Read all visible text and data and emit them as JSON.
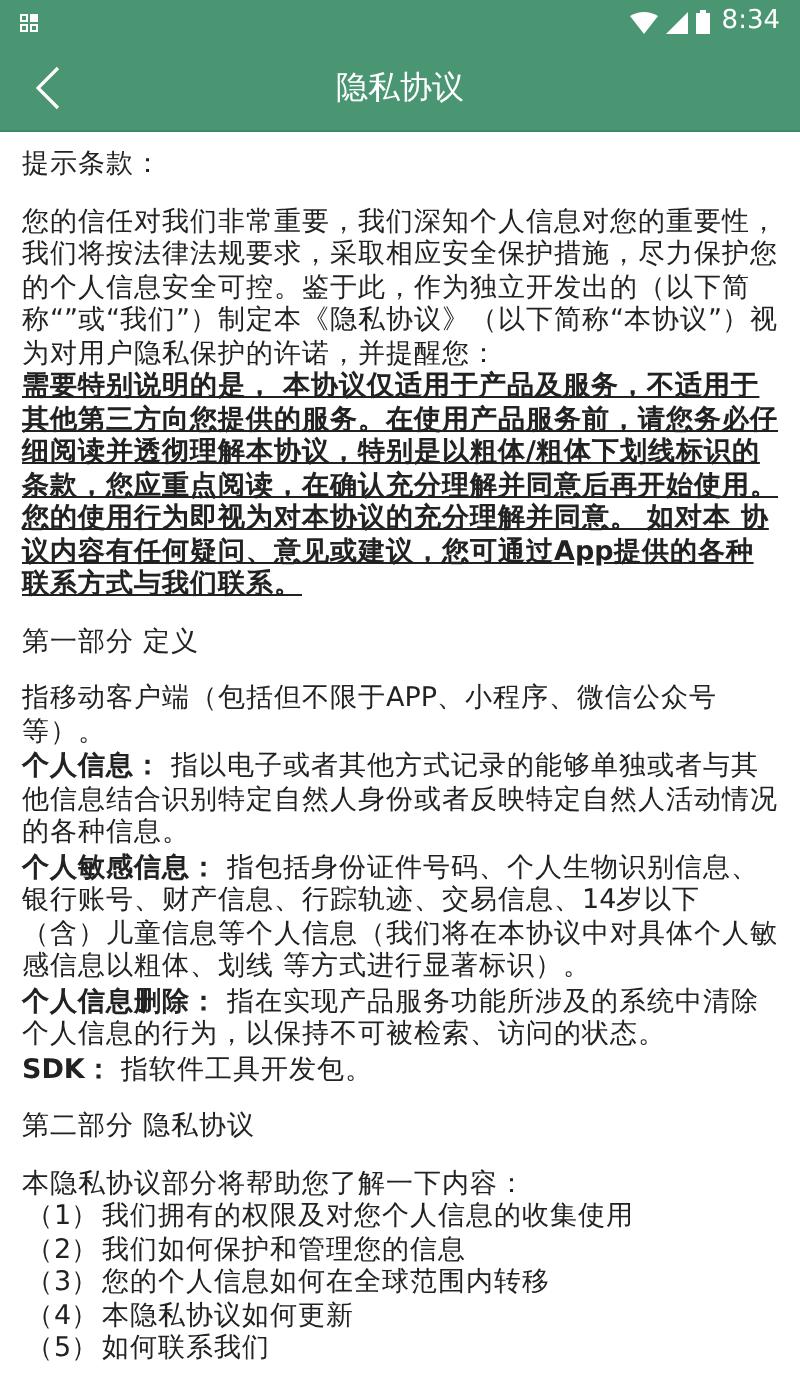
{
  "status_bar": {
    "time": "8:34"
  },
  "header": {
    "title": "隐私协议"
  },
  "blocks": [
    {
      "kind": "paragraph",
      "text": "提示条款："
    },
    {
      "kind": "gap"
    },
    {
      "kind": "paragraph",
      "text": "您的信任对我们非常重要，我们深知个人信息对您的重要性，我们将按法律法规要求，采取相应安全保护措施，尽力保护您的个人信息安全可控。鉴于此，作为独立开发出的（以下简称“”或“我们”）制定本《隐私协议》（以下简称“本协议”）视为对用户隐私保护的许诺，并提醒您："
    },
    {
      "kind": "notice",
      "text": "需要特别说明的是， 本协议仅适用于产品及服务，不适用于其他第三方向您提供的服务。在使用产品服务前，请您务必仔细阅读并透彻理解本协议，特别是以粗体/粗体下划线标识的条款，您应重点阅读，在确认充分理解并同意后再开始使用。您的使用行为即视为对本协议的充分理解并同意。 如对本 协议内容有任何疑问、意见或建议，您可通过App提供的各种联系方式与我们联系。"
    },
    {
      "kind": "gap"
    },
    {
      "kind": "paragraph",
      "text": "第一部分  定义"
    },
    {
      "kind": "gap"
    },
    {
      "kind": "paragraph",
      "text": "指移动客户端（包括但不限于APP、小程序、微信公众号等）。"
    },
    {
      "kind": "definition",
      "term": "个人信息：",
      "text": " 指以电子或者其他方式记录的能够单独或者与其他信息结合识别特定自然人身份或者反映特定自然人活动情况的各种信息。"
    },
    {
      "kind": "definition",
      "term": "个人敏感信息：",
      "text": " 指包括身份证件号码、个人生物识别信息、银行账号、财产信息、行踪轨迹、交易信息、14岁以下（含）儿童信息等个人信息（我们将在本协议中对具体个人敏感信息以粗体、划线 等方式进行显著标识）。"
    },
    {
      "kind": "definition",
      "term": "个人信息删除：",
      "text": " 指在实现产品服务功能所涉及的系统中清除个人信息的行为，以保持不可被检索、访问的状态。"
    },
    {
      "kind": "definition",
      "term": "SDK：",
      "text": " 指软件工具开发包。"
    },
    {
      "kind": "gap"
    },
    {
      "kind": "paragraph",
      "text": "第二部分 隐私协议"
    },
    {
      "kind": "gap"
    },
    {
      "kind": "paragraph",
      "text": "本隐私协议部分将帮助您了解一下内容："
    },
    {
      "kind": "list_item",
      "marker": "（1）",
      "text": "我们拥有的权限及对您个人信息的收集使用"
    },
    {
      "kind": "list_item",
      "marker": "（2）",
      "text": "我们如何保护和管理您的信息"
    },
    {
      "kind": "list_item",
      "marker": "（3）",
      "text": "您的个人信息如何在全球范围内转移"
    },
    {
      "kind": "list_item",
      "marker": "（4）",
      "text": "本隐私协议如何更新"
    },
    {
      "kind": "list_item",
      "marker": "（5）",
      "text": "如何联系我们"
    }
  ]
}
